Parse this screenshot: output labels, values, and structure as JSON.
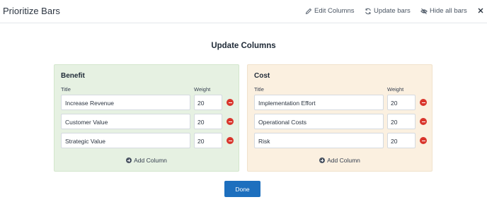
{
  "header": {
    "title": "Prioritize Bars",
    "actions": {
      "edit_columns": "Edit Columns",
      "update_bars": "Update bars",
      "hide_all_bars": "Hide all bars"
    }
  },
  "section_title": "Update Columns",
  "benefit": {
    "title": "Benefit",
    "title_header": "Title",
    "weight_header": "Weight",
    "rows": [
      {
        "title": "Increase Revenue",
        "weight": "20"
      },
      {
        "title": "Customer Value",
        "weight": "20"
      },
      {
        "title": "Strategic Value",
        "weight": "20"
      }
    ],
    "add_label": "Add Column",
    "background": "#e6f1e2"
  },
  "cost": {
    "title": "Cost",
    "title_header": "Title",
    "weight_header": "Weight",
    "rows": [
      {
        "title": "Implementation Effort",
        "weight": "20"
      },
      {
        "title": "Operational Costs",
        "weight": "20"
      },
      {
        "title": "Risk",
        "weight": "20"
      }
    ],
    "add_label": "Add Column",
    "background": "#fbf0e0"
  },
  "done_label": "Done",
  "colors": {
    "primary": "#1d6fbe",
    "remove": "#d9352c"
  },
  "icons": {
    "edit": "pencil-icon",
    "update": "refresh-icon",
    "hide": "eye-slash-icon",
    "close": "close-icon",
    "remove": "minus-circle-icon",
    "add": "plus-circle-icon"
  }
}
